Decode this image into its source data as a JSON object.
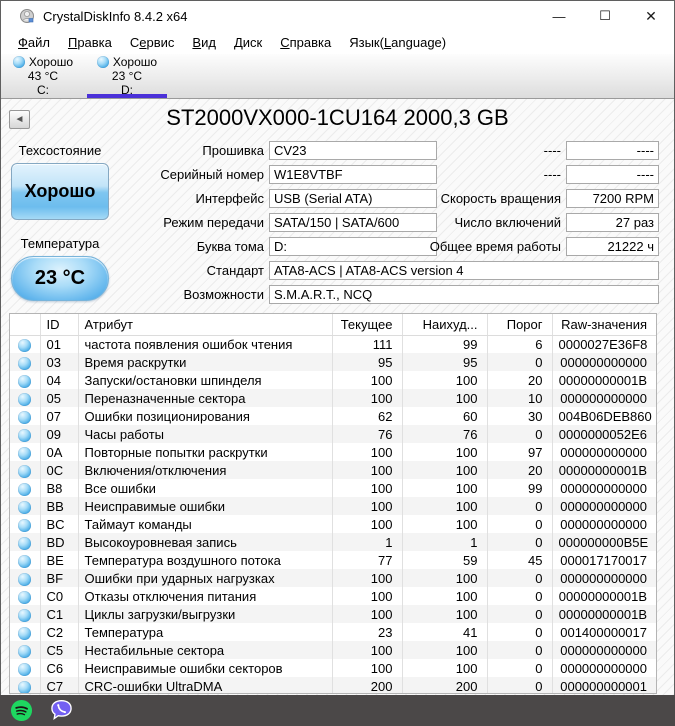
{
  "window": {
    "title": "CrystalDiskInfo 8.4.2 x64",
    "controls": {
      "minimize": "—",
      "maximize": "☐",
      "close": "✕"
    }
  },
  "menu": {
    "items": [
      {
        "id": "file",
        "pre": "",
        "accel": "Ф",
        "post": "айл"
      },
      {
        "id": "edit",
        "pre": "",
        "accel": "П",
        "post": "равка"
      },
      {
        "id": "function",
        "pre": "С",
        "accel": "е",
        "post": "рвис"
      },
      {
        "id": "view",
        "pre": "",
        "accel": "В",
        "post": "ид"
      },
      {
        "id": "disk",
        "pre": "",
        "accel": "Д",
        "post": "иск"
      },
      {
        "id": "help",
        "pre": "",
        "accel": "С",
        "post": "правка"
      },
      {
        "id": "language",
        "pre": "Язык(",
        "accel": "L",
        "post": "anguage)"
      }
    ]
  },
  "disk_tabs": [
    {
      "id": "c",
      "status": "Хорошо",
      "temperature": "43 °C",
      "drive": "C:",
      "selected": false
    },
    {
      "id": "d",
      "status": "Хорошо",
      "temperature": "23 °C",
      "drive": "D:",
      "selected": true
    }
  ],
  "drive": {
    "title": "ST2000VX000-1CU164 2000,3 GB"
  },
  "health": {
    "label": "Техсостояние",
    "value": "Хорошо"
  },
  "temperature": {
    "label": "Температура",
    "value": "23 °C"
  },
  "info_fields": {
    "left": [
      {
        "label": "Прошивка",
        "value": "CV23",
        "wide": false
      },
      {
        "label": "Серийный номер",
        "value": "W1E8VTBF",
        "wide": false
      },
      {
        "label": "Интерфейс",
        "value": "USB (Serial ATA)",
        "wide": false
      },
      {
        "label": "Режим передачи",
        "value": "SATA/150 | SATA/600",
        "wide": false
      },
      {
        "label": "Буква тома",
        "value": "D:",
        "wide": false
      },
      {
        "label": "Стандарт",
        "value": "ATA8-ACS | ATA8-ACS version 4",
        "wide": true
      },
      {
        "label": "Возможности",
        "value": "S.M.A.R.T., NCQ",
        "wide": true
      }
    ],
    "right": [
      {
        "label": "----",
        "value": "----"
      },
      {
        "label": "----",
        "value": "----"
      },
      {
        "label": "Скорость вращения",
        "value": "7200 RPM"
      },
      {
        "label": "Число включений",
        "value": "27 раз"
      },
      {
        "label": "Общее время работы",
        "value": "21222 ч"
      }
    ]
  },
  "table": {
    "headers": [
      "",
      "ID",
      "Атрибут",
      "Текущее",
      "Наихуд...",
      "Порог",
      "Raw-значения"
    ],
    "rows": [
      {
        "id": "01",
        "attribute": "частота появления ошибок чтения",
        "current": "111",
        "worst": "99",
        "threshold": "6",
        "raw": "0000027E36F8"
      },
      {
        "id": "03",
        "attribute": "Время раскрутки",
        "current": "95",
        "worst": "95",
        "threshold": "0",
        "raw": "000000000000"
      },
      {
        "id": "04",
        "attribute": "Запуски/остановки шпинделя",
        "current": "100",
        "worst": "100",
        "threshold": "20",
        "raw": "00000000001B"
      },
      {
        "id": "05",
        "attribute": "Переназначенные сектора",
        "current": "100",
        "worst": "100",
        "threshold": "10",
        "raw": "000000000000"
      },
      {
        "id": "07",
        "attribute": "Ошибки позиционирования",
        "current": "62",
        "worst": "60",
        "threshold": "30",
        "raw": "004B06DEB860"
      },
      {
        "id": "09",
        "attribute": "Часы работы",
        "current": "76",
        "worst": "76",
        "threshold": "0",
        "raw": "0000000052E6"
      },
      {
        "id": "0A",
        "attribute": "Повторные попытки раскрутки",
        "current": "100",
        "worst": "100",
        "threshold": "97",
        "raw": "000000000000"
      },
      {
        "id": "0C",
        "attribute": "Включения/отключения",
        "current": "100",
        "worst": "100",
        "threshold": "20",
        "raw": "00000000001B"
      },
      {
        "id": "B8",
        "attribute": "Все ошибки",
        "current": "100",
        "worst": "100",
        "threshold": "99",
        "raw": "000000000000"
      },
      {
        "id": "BB",
        "attribute": "Неисправимые ошибки",
        "current": "100",
        "worst": "100",
        "threshold": "0",
        "raw": "000000000000"
      },
      {
        "id": "BC",
        "attribute": "Таймаут команды",
        "current": "100",
        "worst": "100",
        "threshold": "0",
        "raw": "000000000000"
      },
      {
        "id": "BD",
        "attribute": "Высокоуровневая запись",
        "current": "1",
        "worst": "1",
        "threshold": "0",
        "raw": "000000000B5E"
      },
      {
        "id": "BE",
        "attribute": "Температура воздушного потока",
        "current": "77",
        "worst": "59",
        "threshold": "45",
        "raw": "000017170017"
      },
      {
        "id": "BF",
        "attribute": "Ошибки при ударных нагрузках",
        "current": "100",
        "worst": "100",
        "threshold": "0",
        "raw": "000000000000"
      },
      {
        "id": "C0",
        "attribute": "Отказы отключения питания",
        "current": "100",
        "worst": "100",
        "threshold": "0",
        "raw": "00000000001B"
      },
      {
        "id": "C1",
        "attribute": "Циклы загрузки/выгрузки",
        "current": "100",
        "worst": "100",
        "threshold": "0",
        "raw": "00000000001B"
      },
      {
        "id": "C2",
        "attribute": "Температура",
        "current": "23",
        "worst": "41",
        "threshold": "0",
        "raw": "001400000017"
      },
      {
        "id": "C5",
        "attribute": "Нестабильные сектора",
        "current": "100",
        "worst": "100",
        "threshold": "0",
        "raw": "000000000000"
      },
      {
        "id": "C6",
        "attribute": "Неисправимые ошибки секторов",
        "current": "100",
        "worst": "100",
        "threshold": "0",
        "raw": "000000000000"
      },
      {
        "id": "C7",
        "attribute": "CRC-ошибки UltraDMA",
        "current": "200",
        "worst": "200",
        "threshold": "0",
        "raw": "000000000001"
      }
    ]
  },
  "taskbar": {
    "icons": [
      "spotify-icon",
      "viber-icon"
    ]
  },
  "colors": {
    "selected_tab_underline": "#4a30d8",
    "status_good_button": "#7fc6f0",
    "taskbar_bg": "#4b4848",
    "spotify_green": "#1ed760",
    "viber_purple": "#7360f2"
  }
}
